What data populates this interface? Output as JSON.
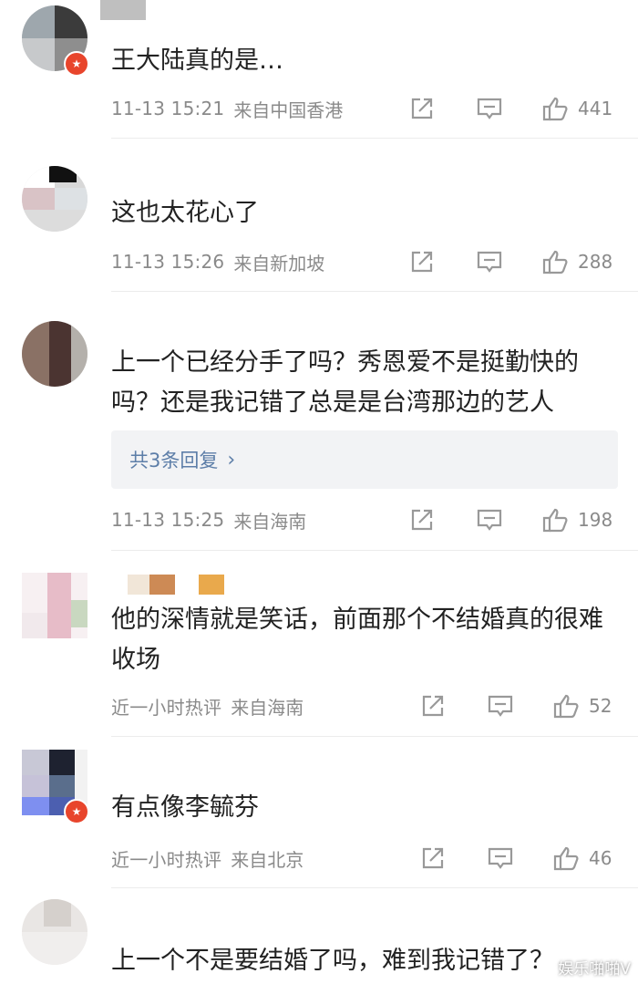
{
  "comments": [
    {
      "text": "王大陆真的是…",
      "time": "11-13 15:21",
      "location": "来自中国香港",
      "likes": "441",
      "has_badge": true
    },
    {
      "text": "这也太花心了",
      "time": "11-13 15:26",
      "location": "来自新加坡",
      "likes": "288",
      "has_badge": false
    },
    {
      "text": "上一个已经分手了吗？秀恩爱不是挺勤快的吗？还是我记错了总是是台湾那边的艺人",
      "time": "11-13 15:25",
      "location": "来自海南",
      "likes": "198",
      "replies_label": "共3条回复",
      "has_badge": false
    },
    {
      "text": "他的深情就是笑话，前面那个不结婚真的很难收场",
      "time": "近一小时热评",
      "location": "来自海南",
      "likes": "52",
      "has_badge": false
    },
    {
      "text": "有点像李毓芬",
      "time": "近一小时热评",
      "location": "来自北京",
      "likes": "46",
      "has_badge": true
    },
    {
      "text": "上一个不是要结婚了吗，难到我记错了？",
      "has_badge": false
    }
  ],
  "icons": {
    "share": "share-icon",
    "comment": "comment-icon",
    "like": "thumbs-up-icon",
    "badge": "verified-badge-icon",
    "reply_chevron": "chevron-right-icon"
  },
  "colors": {
    "text": "#222222",
    "meta": "#8a8a8a",
    "link": "#5d7ea8",
    "reply_bg": "#f2f3f5",
    "badge": "#e8452c"
  },
  "watermark": "娱乐啪啪V"
}
